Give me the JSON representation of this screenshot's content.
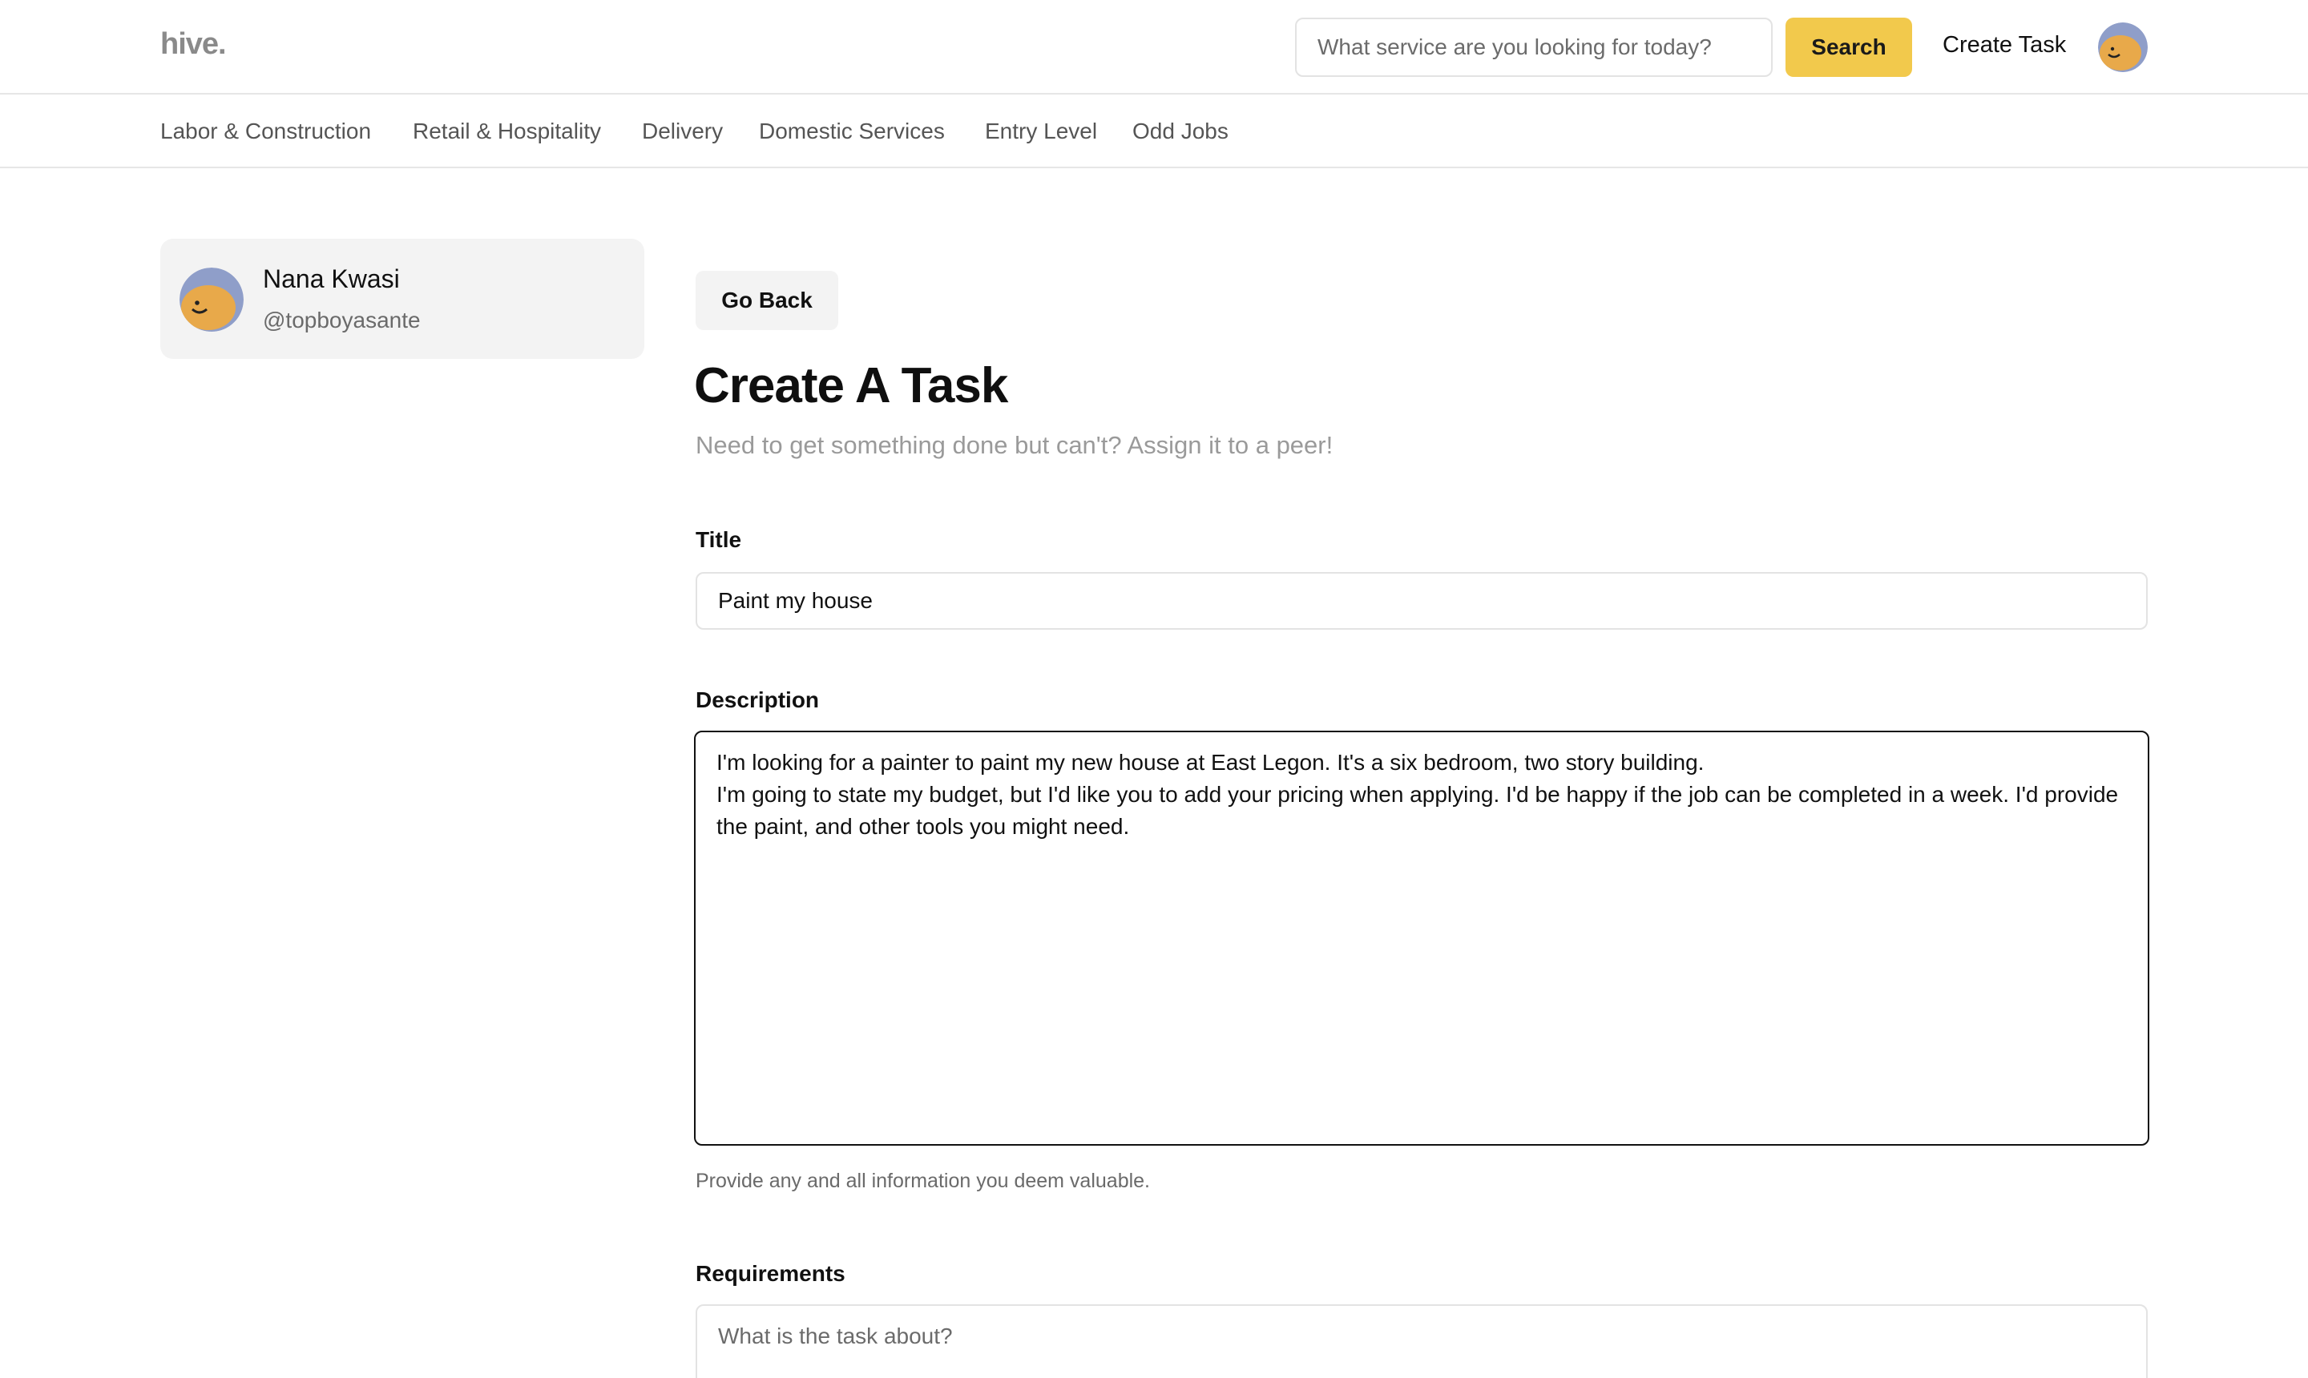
{
  "header": {
    "logo_text": "hive.",
    "search_placeholder": "What service are you looking for today?",
    "search_button_label": "Search",
    "create_task_label": "Create Task",
    "avatar_icon": "user-avatar-icon"
  },
  "categories": [
    "Labor & Construction",
    "Retail & Hospitality",
    "Delivery",
    "Domestic Services",
    "Entry Level",
    "Odd Jobs"
  ],
  "profile": {
    "name": "Nana Kwasi",
    "handle": "@topboyasante"
  },
  "main": {
    "go_back_label": "Go Back",
    "title": "Create A Task",
    "subtitle": "Need to get something done but can't? Assign it to a peer!",
    "form": {
      "title_label": "Title",
      "title_value": "Paint my house",
      "description_label": "Description",
      "description_value": "I'm looking for a painter to paint my new house at East Legon. It's a six bedroom, two story building.\nI'm going to state my budget, but I'd like you to add your pricing when applying. I'd be happy if the job can be completed in a week. I'd provide the paint, and other tools you might need.",
      "description_hint": "Provide any and all information you deem valuable.",
      "requirements_label": "Requirements",
      "requirements_placeholder": "What is the task about?"
    }
  },
  "colors": {
    "accent": "#f2c94c",
    "avatar_bg": "#8f9ec9",
    "avatar_face": "#e8a94a"
  }
}
